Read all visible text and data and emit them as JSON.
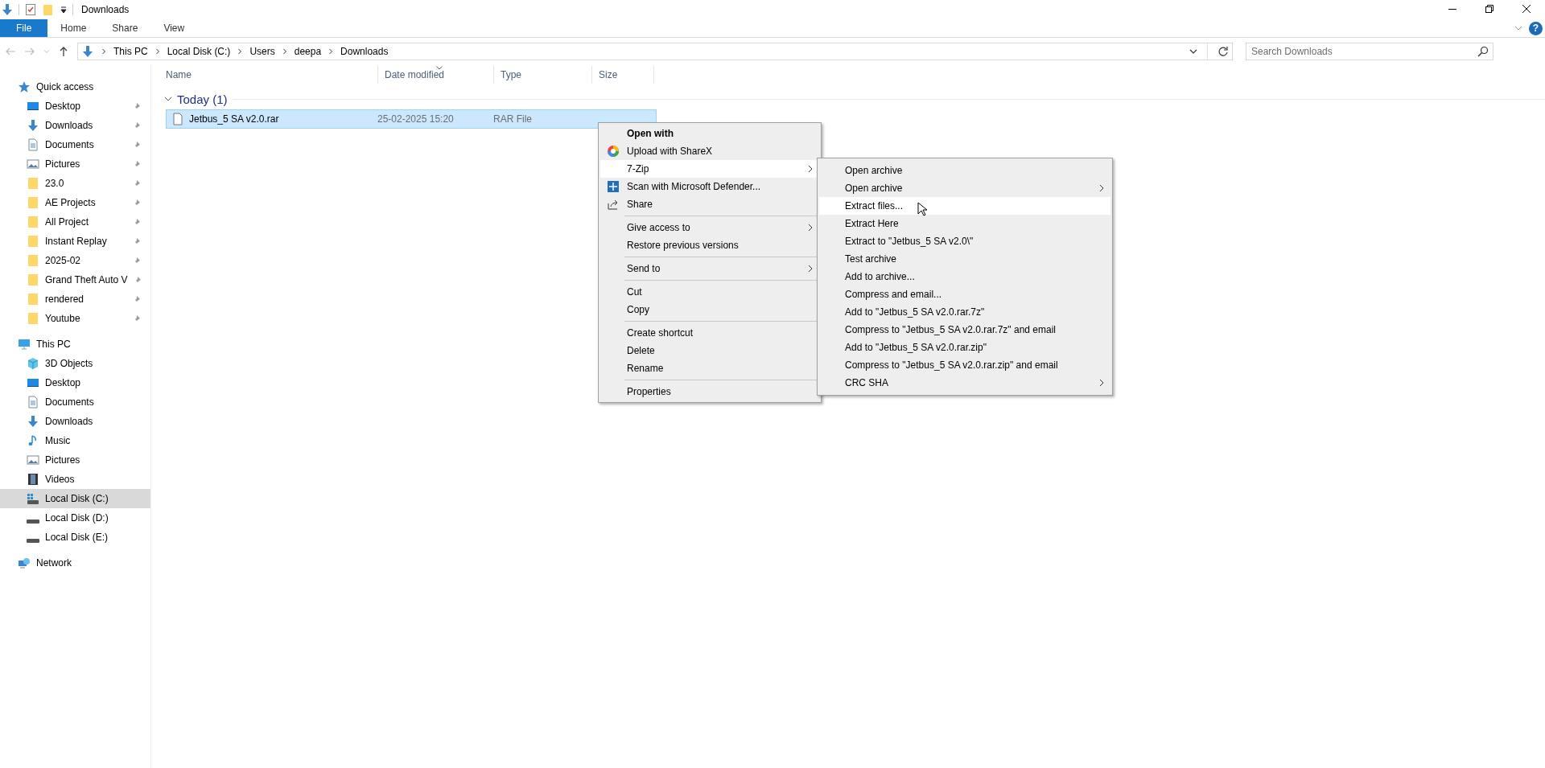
{
  "title_bar": {
    "title": "Downloads"
  },
  "ribbon": {
    "tabs": [
      {
        "label": "File",
        "kind": "file"
      },
      {
        "label": "Home",
        "kind": "tab"
      },
      {
        "label": "Share",
        "kind": "tab"
      },
      {
        "label": "View",
        "kind": "tab"
      }
    ],
    "help": "?"
  },
  "address_bar": {
    "path": [
      "This PC",
      "Local Disk (C:)",
      "Users",
      "deepa",
      "Downloads"
    ]
  },
  "search": {
    "placeholder": "Search Downloads"
  },
  "sidebar": {
    "sections": [
      {
        "label": "Quick access",
        "kind": "star",
        "items": [
          {
            "label": "Desktop",
            "kind": "desktop",
            "pinned": true,
            "selected": false
          },
          {
            "label": "Downloads",
            "kind": "download",
            "pinned": true,
            "selected": false
          },
          {
            "label": "Documents",
            "kind": "document",
            "pinned": true,
            "selected": false
          },
          {
            "label": "Pictures",
            "kind": "picture",
            "pinned": true,
            "selected": false
          },
          {
            "label": "23.0",
            "kind": "folder",
            "pinned": true,
            "selected": false
          },
          {
            "label": "AE Projects",
            "kind": "folder",
            "pinned": true,
            "selected": false
          },
          {
            "label": "All Project",
            "kind": "folder",
            "pinned": true,
            "selected": false
          },
          {
            "label": "Instant Replay",
            "kind": "folder",
            "pinned": true,
            "selected": false
          },
          {
            "label": "2025-02",
            "kind": "folder",
            "pinned": true,
            "selected": false
          },
          {
            "label": "Grand Theft Auto V",
            "kind": "folder",
            "pinned": true,
            "selected": false
          },
          {
            "label": "rendered",
            "kind": "folder",
            "pinned": true,
            "selected": false
          },
          {
            "label": "Youtube",
            "kind": "folder",
            "pinned": true,
            "selected": false
          }
        ]
      },
      {
        "label": "This PC",
        "kind": "pc",
        "items": [
          {
            "label": "3D Objects",
            "kind": "cube",
            "pinned": false,
            "selected": false
          },
          {
            "label": "Desktop",
            "kind": "desktop",
            "pinned": false,
            "selected": false
          },
          {
            "label": "Documents",
            "kind": "document",
            "pinned": false,
            "selected": false
          },
          {
            "label": "Downloads",
            "kind": "download",
            "pinned": false,
            "selected": false
          },
          {
            "label": "Music",
            "kind": "music",
            "pinned": false,
            "selected": false
          },
          {
            "label": "Pictures",
            "kind": "picture",
            "pinned": false,
            "selected": false
          },
          {
            "label": "Videos",
            "kind": "video",
            "pinned": false,
            "selected": false
          },
          {
            "label": "Local Disk (C:)",
            "kind": "system-disk",
            "pinned": false,
            "selected": true
          },
          {
            "label": "Local Disk (D:)",
            "kind": "disk",
            "pinned": false,
            "selected": false
          },
          {
            "label": "Local Disk (E:)",
            "kind": "disk",
            "pinned": false,
            "selected": false
          }
        ]
      },
      {
        "label": "Network",
        "kind": "network"
      }
    ]
  },
  "file_list": {
    "columns": [
      {
        "label": "Name",
        "sorted": false
      },
      {
        "label": "Date modified",
        "sorted": true
      },
      {
        "label": "Type",
        "sorted": false
      },
      {
        "label": "Size",
        "sorted": false
      }
    ],
    "groups": [
      {
        "label": "Today (1)",
        "expanded": true,
        "rows": [
          {
            "name": "Jetbus_5 SA v2.0.rar",
            "date": "25-02-2025 15:20",
            "type": "RAR File",
            "selected": true
          }
        ]
      }
    ]
  },
  "context_menu": {
    "groups": [
      [
        {
          "label": "Open with",
          "kind": "plain",
          "default": true,
          "submenu": false,
          "selected": false
        },
        {
          "label": "Upload with ShareX",
          "kind": "app",
          "default": false,
          "submenu": false,
          "selected": false
        },
        {
          "label": "7-Zip",
          "kind": "plain",
          "default": false,
          "submenu": true,
          "selected": true
        },
        {
          "label": "Scan with Microsoft Defender...",
          "kind": "shield",
          "default": false,
          "submenu": false,
          "selected": false
        },
        {
          "label": "Share",
          "kind": "share",
          "default": false,
          "submenu": false,
          "selected": false
        }
      ],
      [
        {
          "label": "Give access to",
          "kind": "plain",
          "default": false,
          "submenu": true,
          "selected": false
        },
        {
          "label": "Restore previous versions",
          "kind": "plain",
          "default": false,
          "submenu": false,
          "selected": false
        }
      ],
      [
        {
          "label": "Send to",
          "kind": "plain",
          "default": false,
          "submenu": true,
          "selected": false
        }
      ],
      [
        {
          "label": "Cut",
          "kind": "plain",
          "default": false,
          "submenu": false,
          "selected": false
        },
        {
          "label": "Copy",
          "kind": "plain",
          "default": false,
          "submenu": false,
          "selected": false
        }
      ],
      [
        {
          "label": "Create shortcut",
          "kind": "plain",
          "default": false,
          "submenu": false,
          "selected": false
        },
        {
          "label": "Delete",
          "kind": "plain",
          "default": false,
          "submenu": false,
          "selected": false
        },
        {
          "label": "Rename",
          "kind": "plain",
          "default": false,
          "submenu": false,
          "selected": false
        }
      ],
      [
        {
          "label": "Properties",
          "kind": "plain",
          "default": false,
          "submenu": false,
          "selected": false
        }
      ]
    ]
  },
  "submenu": {
    "items": [
      {
        "label": "Open archive",
        "submenu": false,
        "selected": false
      },
      {
        "label": "Open archive",
        "submenu": true,
        "selected": false
      },
      {
        "label": "Extract files...",
        "submenu": false,
        "selected": true
      },
      {
        "label": "Extract Here",
        "submenu": false,
        "selected": false
      },
      {
        "label": "Extract to \"Jetbus_5 SA v2.0\\\"",
        "submenu": false,
        "selected": false
      },
      {
        "label": "Test archive",
        "submenu": false,
        "selected": false
      },
      {
        "label": "Add to archive...",
        "submenu": false,
        "selected": false
      },
      {
        "label": "Compress and email...",
        "submenu": false,
        "selected": false
      },
      {
        "label": "Add to \"Jetbus_5 SA v2.0.rar.7z\"",
        "submenu": false,
        "selected": false
      },
      {
        "label": "Compress to \"Jetbus_5 SA v2.0.rar.7z\" and email",
        "submenu": false,
        "selected": false
      },
      {
        "label": "Add to \"Jetbus_5 SA v2.0.rar.zip\"",
        "submenu": false,
        "selected": false
      },
      {
        "label": "Compress to \"Jetbus_5 SA v2.0.rar.zip\" and email",
        "submenu": false,
        "selected": false
      },
      {
        "label": "CRC SHA",
        "submenu": true,
        "selected": false
      }
    ]
  }
}
